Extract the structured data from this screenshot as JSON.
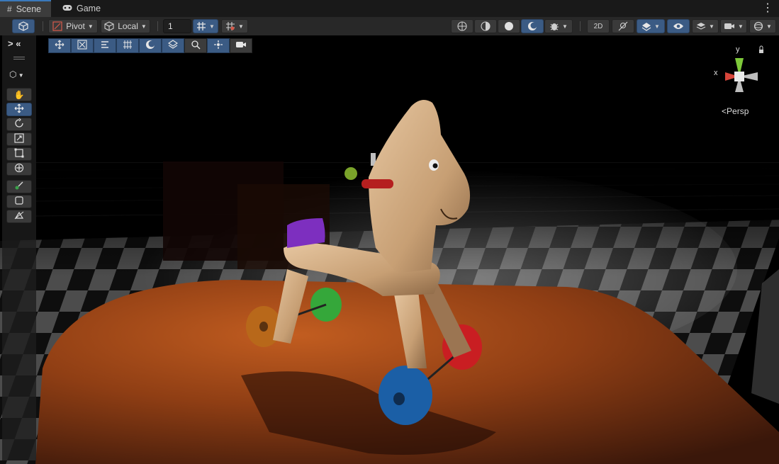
{
  "tabs": [
    {
      "label": "Scene",
      "icon": "grid-icon",
      "active": true
    },
    {
      "label": "Game",
      "icon": "gamepad-icon",
      "active": false
    }
  ],
  "toolbar": {
    "pivot_label": "Pivot",
    "local_label": "Local",
    "grid_size_value": "1",
    "accent_color": "#3b5b84"
  },
  "overlay": {
    "collapse_label": "> «",
    "tools": [
      "hand-tool-icon",
      "move-tool-icon",
      "rotate-tool-icon",
      "scale-tool-icon",
      "rect-tool-icon",
      "transform-tool-icon",
      "custom-tool-icon",
      "shape-tool-icon",
      "probe-tool-icon"
    ]
  },
  "scene_toolbar_icons": [
    "move-icon",
    "scale-nodes-icon",
    "align-icon",
    "grid-snap-icon",
    "rotate-sphere-icon",
    "navmesh-icon",
    "search-icon",
    "pivot-icon",
    "camera-icon"
  ],
  "gizmo": {
    "x_label": "x",
    "y_label": "y",
    "projection_label": "Persp"
  }
}
